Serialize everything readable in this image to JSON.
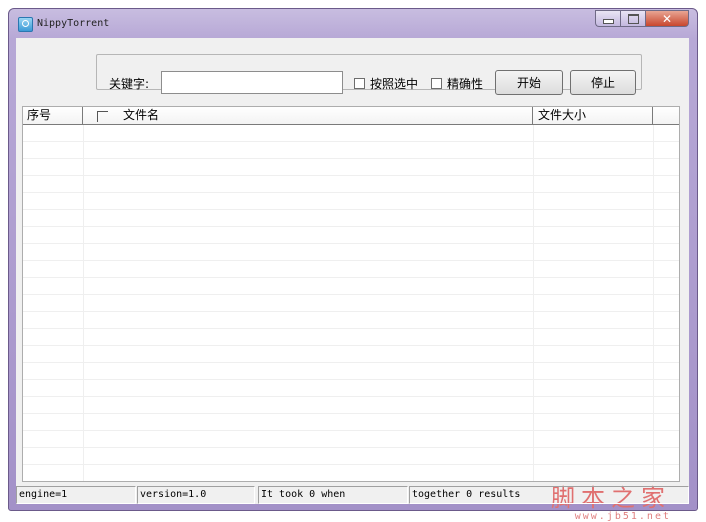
{
  "window": {
    "title": "NippyTorrent"
  },
  "search": {
    "keyword_label": "关键字:",
    "value": "",
    "select_label": "按照选中",
    "accuracy_label": "精确性",
    "start_label": "开始",
    "stop_label": "停止"
  },
  "list": {
    "columns": {
      "no": "序号",
      "name": "文件名",
      "size": "文件大小"
    }
  },
  "status": {
    "engine": "engine=1",
    "version": "version=1.0",
    "took": "It took 0 when",
    "results": "together 0 results"
  },
  "watermark": {
    "title": "脚本之家",
    "url": "www.jb51.net"
  },
  "colors": {
    "titlebar": "#b7a8d6",
    "close": "#c9462d",
    "watermark": "#e07070"
  }
}
